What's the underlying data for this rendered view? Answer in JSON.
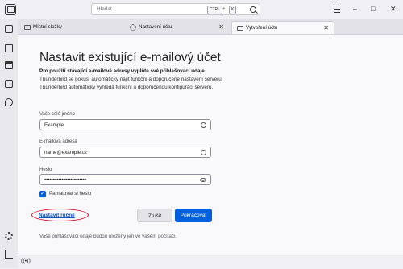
{
  "titlebar": {
    "search_placeholder": "Hledat...",
    "shortcut_keys": [
      "CTRL",
      "K"
    ],
    "shortcut_plus": "+",
    "icons": [
      "app-icon",
      "search-icon",
      "hamburger-menu-icon",
      "minimize-icon",
      "maximize-icon",
      "close-icon"
    ],
    "window_buttons": {
      "minimize": "–",
      "maximize": "□",
      "close": "✕"
    }
  },
  "sidebar": {
    "icons": [
      "mail-icon",
      "address-book-icon",
      "calendar-icon",
      "tasks-icon",
      "chat-icon",
      "settings-icon",
      "collapse-sidebar-icon"
    ]
  },
  "tabs": [
    {
      "label": "Místní složky",
      "icon": "folder-icon",
      "active": false
    },
    {
      "label": "Nastavení účtu",
      "icon": "settings-icon",
      "active": false
    },
    {
      "label": "Vytvoření účtu",
      "icon": "mail-icon",
      "active": true
    }
  ],
  "tab_close_glyph": "✕",
  "form": {
    "title": "Nastavit existující e-mailový účet",
    "intro_bold": "Pro použití stávající e-mailové adresy vyplňte své přihlašovací údaje.",
    "intro_line2": "Thunderbird se pokusí automaticky najít funkční a doporučené nastavení serveru.",
    "intro_line3": "Thunderbird automaticky vyhledá funkční a doporučenou konfiguraci serveru.",
    "name_label": "Vaše celé jméno",
    "name_value": "Example",
    "email_label": "E-mailová adresa",
    "email_value": "name@example.cz",
    "password_label": "Heslo",
    "password_value": "••••••••••••••••••••••••",
    "remember_label": "Pamatovat si heslo",
    "remember_checked": true,
    "manual_setup_link": "Nastavit ručně",
    "cancel_button": "Zrušit",
    "continue_button": "Pokračovat",
    "footer_note": "Vaše přihlašovací údaje budou uloženy jen ve vašem počítači."
  },
  "statusbar": {
    "icon": "activity-icon",
    "glyph": "((•))"
  },
  "colors": {
    "accent": "#0061e0",
    "annotation_circle": "#d70022",
    "link": "#0b54c4",
    "background": "#f9f9fb"
  }
}
